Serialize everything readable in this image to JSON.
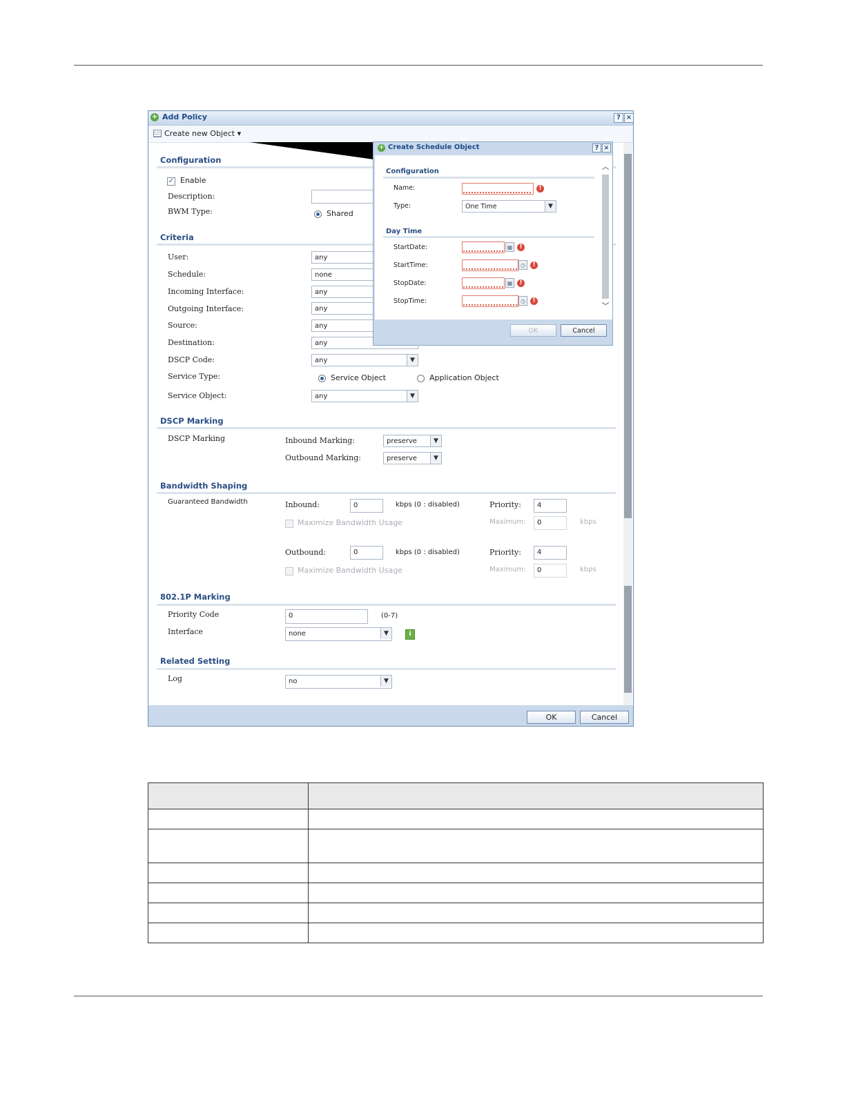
{
  "window": {
    "title": "Add Policy",
    "toolbar_create": "Create new Object",
    "configuration": {
      "heading": "Configuration",
      "enable_label": "Enable",
      "description_label": "Description:",
      "description_value": "",
      "bwm_type_label": "BWM Type:",
      "bwm_type_option": "Shared"
    },
    "criteria": {
      "heading": "Criteria",
      "user_label": "User:",
      "user_value": "any",
      "schedule_label": "Schedule:",
      "schedule_value": "none",
      "incoming_label": "Incoming Interface:",
      "incoming_value": "any",
      "outgoing_label": "Outgoing Interface:",
      "outgoing_value": "any",
      "source_label": "Source:",
      "source_value": "any",
      "destination_label": "Destination:",
      "destination_value": "any",
      "dscp_label": "DSCP Code:",
      "dscp_value": "any",
      "service_type_label": "Service Type:",
      "service_type_option1": "Service Object",
      "service_type_option2": "Application Object",
      "service_object_label": "Service Object:",
      "service_object_value": "any"
    },
    "dscp_marking": {
      "heading": "DSCP Marking",
      "label": "DSCP Marking",
      "inbound_label": "Inbound Marking:",
      "inbound_value": "preserve",
      "outbound_label": "Outbound Marking:",
      "outbound_value": "preserve"
    },
    "bandwidth_shaping": {
      "heading": "Bandwidth Shaping",
      "guaranteed_label": "Guaranteed Bandwidth",
      "inbound_label": "Inbound:",
      "inbound_value": "0",
      "unit_note": "kbps (0 : disabled)",
      "priority_label": "Priority:",
      "inbound_priority": "4",
      "maximize_label": "Maximize Bandwidth Usage",
      "maximum_label": "Maximum:",
      "inbound_maximum": "0",
      "kbps": "kbps",
      "outbound_label": "Outbound:",
      "outbound_value": "0",
      "outbound_priority": "4",
      "outbound_maximum": "0"
    },
    "p8021_marking": {
      "heading": "802.1P Marking",
      "priority_code_label": "Priority Code",
      "priority_code_value": "0",
      "priority_range": "(0-7)",
      "interface_label": "Interface",
      "interface_value": "none"
    },
    "related_setting": {
      "heading": "Related Setting",
      "log_label": "Log",
      "log_value": "no"
    },
    "ok_label": "OK",
    "cancel_label": "Cancel"
  },
  "dialog": {
    "title": "Create Schedule Object",
    "configuration_heading": "Configuration",
    "name_label": "Name:",
    "type_label": "Type:",
    "type_value": "One Time",
    "daytime_heading": "Day Time",
    "startdate_label": "StartDate:",
    "starttime_label": "StartTime:",
    "stopdate_label": "StopDate:",
    "stoptime_label": "StopTime:",
    "ok_label": "OK",
    "cancel_label": "Cancel"
  },
  "icons": [
    "add-icon",
    "help-icon",
    "close-icon",
    "object-list-icon",
    "warning-icon",
    "calendar-icon",
    "clock-icon",
    "info-icon",
    "chevron-down-icon"
  ]
}
